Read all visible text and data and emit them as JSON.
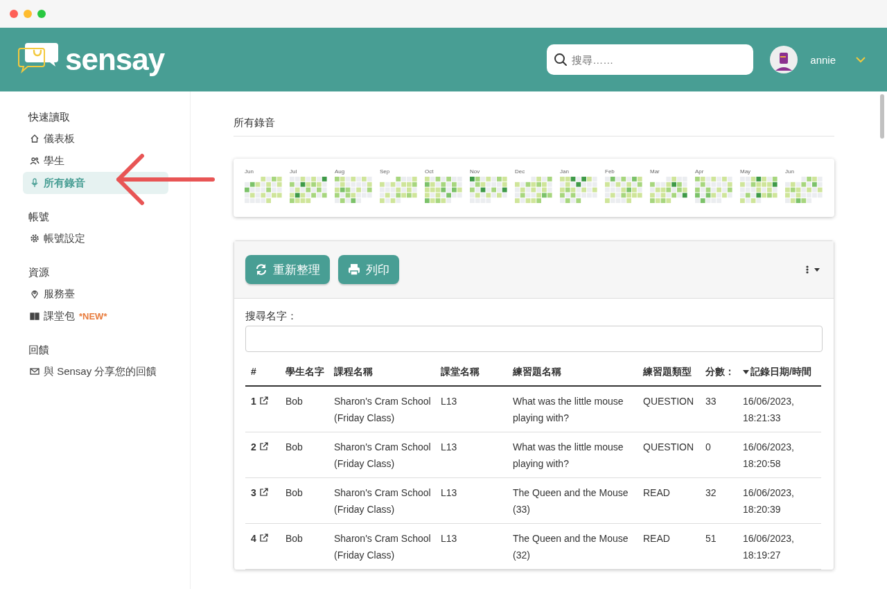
{
  "header": {
    "logo_text": "sensay",
    "search": {
      "placeholder": "搜尋……"
    },
    "user": {
      "name": "annie"
    }
  },
  "sidebar": {
    "sections": [
      {
        "title": "快速讀取",
        "items": [
          {
            "label": "儀表板",
            "kind": "home",
            "selected": false
          },
          {
            "label": "學生",
            "kind": "users",
            "selected": false
          },
          {
            "label": "所有錄音",
            "kind": "mic",
            "selected": true
          }
        ]
      },
      {
        "title": "帳號",
        "items": [
          {
            "label": "帳號設定",
            "kind": "gear",
            "selected": false
          }
        ]
      },
      {
        "title": "資源",
        "items": [
          {
            "label": "服務臺",
            "kind": "pin",
            "selected": false
          },
          {
            "label": "課堂包",
            "badge": "*NEW*",
            "kind": "book",
            "selected": false
          }
        ]
      },
      {
        "title": "回饋",
        "items": [
          {
            "label": "與 Sensay 分享您的回饋",
            "kind": "mail",
            "selected": false
          }
        ]
      }
    ]
  },
  "page_title": "所有錄音",
  "heatmap": {
    "months": [
      "Jun",
      "Jul",
      "Aug",
      "Sep",
      "Oct",
      "Nov",
      "Dec",
      "Jan",
      "Feb",
      "Mar",
      "Apr",
      "May",
      "Jun"
    ]
  },
  "toolbar": {
    "buttons": [
      {
        "label": "重新整理",
        "kind": "refresh"
      },
      {
        "label": "列印",
        "kind": "print"
      }
    ]
  },
  "search_name": {
    "label": "搜尋名字："
  },
  "table": {
    "columns": [
      {
        "label": "#",
        "sorted": false
      },
      {
        "label": "學生名字",
        "sorted": false
      },
      {
        "label": "課程名稱",
        "sorted": false
      },
      {
        "label": "課堂名稱",
        "sorted": false
      },
      {
        "label": "練習題名稱",
        "sorted": false
      },
      {
        "label": "練習題類型",
        "sorted": false
      },
      {
        "label": "分數：",
        "sorted": false
      },
      {
        "label": "記錄日期/時間",
        "sorted": true
      }
    ],
    "rows": [
      {
        "cells": [
          "1",
          "Bob",
          "Sharon's Cram School (Friday Class)",
          "L13",
          "What was the little mouse playing with?",
          "QUESTION",
          "33",
          "16/06/2023, 18:21:33"
        ]
      },
      {
        "cells": [
          "2",
          "Bob",
          "Sharon's Cram School (Friday Class)",
          "L13",
          "What was the little mouse playing with?",
          "QUESTION",
          "0",
          "16/06/2023, 18:20:58"
        ]
      },
      {
        "cells": [
          "3",
          "Bob",
          "Sharon's Cram School (Friday Class)",
          "L13",
          "The Queen and the Mouse (33)",
          "READ",
          "32",
          "16/06/2023, 18:20:39"
        ]
      },
      {
        "cells": [
          "4",
          "Bob",
          "Sharon's Cram School (Friday Class)",
          "L13",
          "The Queen and the Mouse (32)",
          "READ",
          "51",
          "16/06/2023, 18:19:27"
        ]
      }
    ]
  }
}
